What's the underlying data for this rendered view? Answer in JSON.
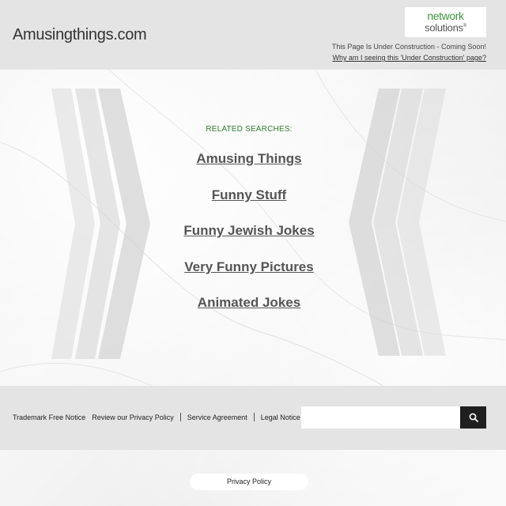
{
  "header": {
    "site_title": "Amusingthings.com",
    "logo_line1": "network",
    "logo_line2": "solutions",
    "logo_mark": "®",
    "construction_text": "This Page Is Under Construction - Coming Soon!",
    "why_link": "Why am I seeing this 'Under Construction' page?"
  },
  "main": {
    "related_label": "RELATED SEARCHES:",
    "links": [
      "Amusing Things",
      "Funny Stuff",
      "Funny Jewish Jokes",
      "Very Funny Pictures",
      "Animated Jokes"
    ]
  },
  "footer": {
    "trademark": "Trademark Free Notice",
    "privacy_review": "Review our Privacy Policy",
    "service": "Service Agreement",
    "legal": "Legal Notice",
    "search_placeholder": "",
    "search_icon": "search-icon",
    "privacy_policy": "Privacy Policy"
  },
  "colors": {
    "header_bg": "#e4e4e4",
    "related_green": "#2f7d2f",
    "logo_green": "#3d9a3d",
    "search_button": "#1f1f1f"
  }
}
